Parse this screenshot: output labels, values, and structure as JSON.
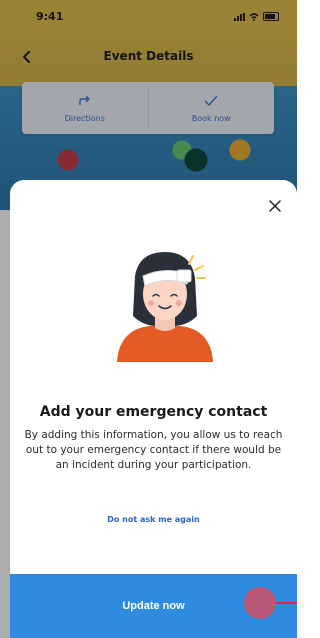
{
  "status_bar": {
    "time": "9:41"
  },
  "nav": {
    "title": "Event Details"
  },
  "actions": {
    "directions_label": "Directions",
    "book_label": "Book now"
  },
  "sheet": {
    "title": "Add your emergency contact",
    "body": "By adding this information, you allow us to reach out to your emergency contact if there would be an incident during your participation.",
    "skip_label": "Do not ask me again",
    "cta_label": "Update now"
  },
  "colors": {
    "accent": "#2f8be0",
    "link": "#2f63c5",
    "header_yellow": "#e5c24f",
    "shirt_orange": "#e35b25"
  },
  "icons": [
    "back-arrow-icon",
    "directions-icon",
    "checkmark-icon",
    "close-icon",
    "injured-person-illustration"
  ]
}
